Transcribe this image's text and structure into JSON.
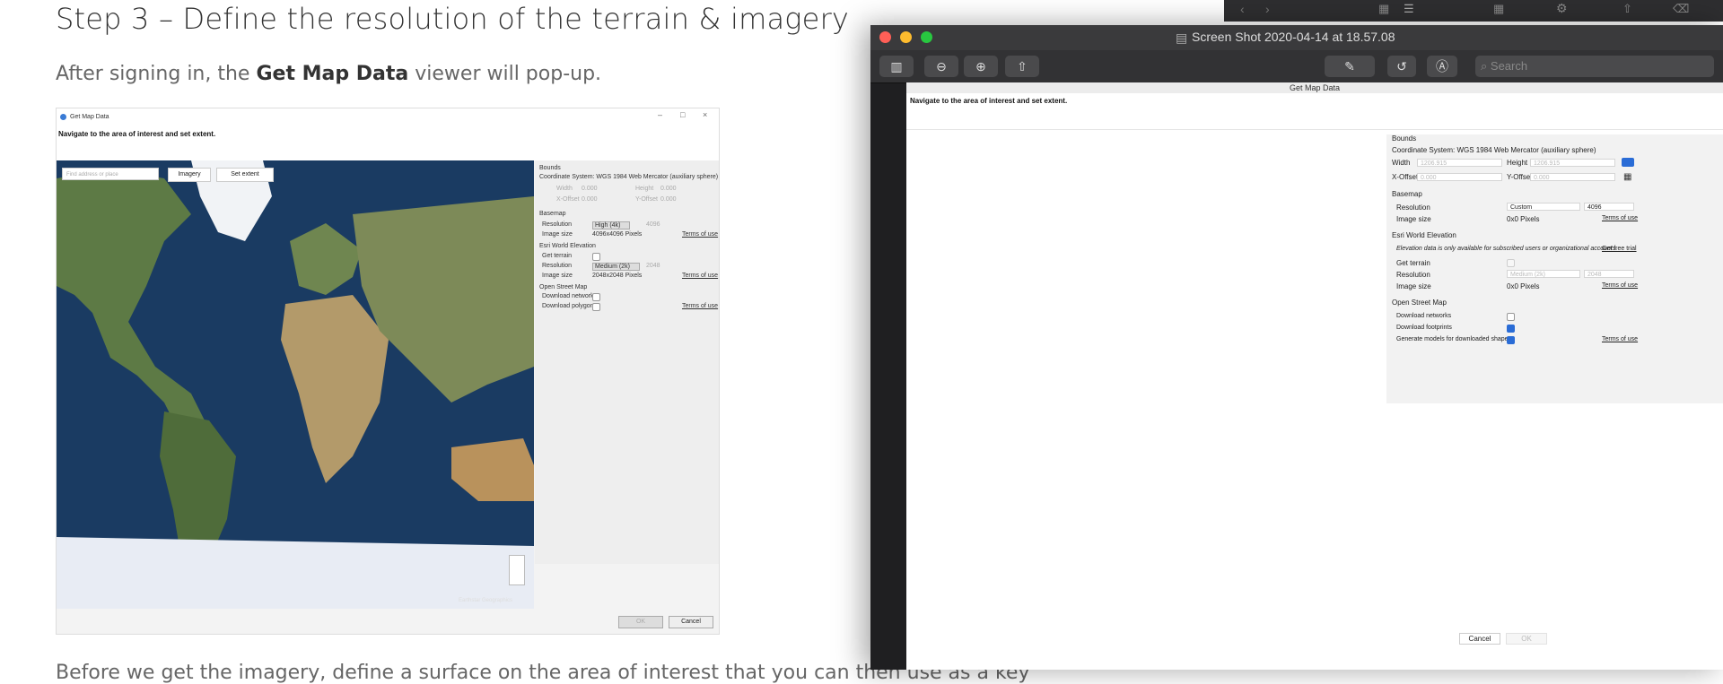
{
  "article": {
    "heading": "Step 3 – Define the resolution of the terrain & imagery",
    "intro_pre": "After signing in, the ",
    "intro_bold": "Get Map Data",
    "intro_post": " viewer will pop-up.",
    "cut_text": "Before we get the imagery, define a surface on the area of interest that you can then use as a key"
  },
  "shot": {
    "window_title": "Get Map Data",
    "instruction": "Navigate to the area of interest and set extent.",
    "search_placeholder": "Find address or place",
    "imagery_button": "Imagery",
    "set_extent_button": "Set extent",
    "attribution": "Earthstar Geographics",
    "bounds_header": "Bounds",
    "coord_system": "Coordinate System: WGS 1984 Web Mercator (auxiliary sphere)",
    "width_label": "Width",
    "width_value": "0.000",
    "height_label": "Height",
    "height_value": "0.000",
    "xoffset_label": "X-Offset",
    "xoffset_value": "0.000",
    "yoffset_label": "Y-Offset",
    "yoffset_value": "0.000",
    "basemap_header": "Basemap",
    "resolution_label": "Resolution",
    "basemap_resolution": "High (4k)",
    "basemap_res_value": "4096",
    "image_size_label": "Image size",
    "basemap_image_size": "4096x4096 Pixels",
    "terms": "Terms of use",
    "elevation_header": "Esri World Elevation",
    "get_terrain_label": "Get terrain",
    "elev_resolution": "Medium (2k)",
    "elev_res_value": "2048",
    "elev_image_size": "2048x2048 Pixels",
    "osm_header": "Open Street Map",
    "download_networks": "Download networks",
    "download_polygons": "Download polygons",
    "ok": "OK",
    "cancel": "Cancel"
  },
  "preview": {
    "title": "Screen Shot 2020-04-14 at 18.57.08",
    "search_placeholder": "Search",
    "doc_title": "Get Map Data",
    "instruction": "Navigate to the area of interest and set extent.",
    "bounds_header": "Bounds",
    "coord_system": "Coordinate System: WGS 1984 Web Mercator (auxiliary sphere)",
    "width_label": "Width",
    "width_value": "1206.915",
    "height_label": "Height",
    "height_value": "1206.915",
    "xoffset_label": "X-Offset",
    "xoffset_value": "0.000",
    "yoffset_label": "Y-Offset",
    "yoffset_value": "0.000",
    "basemap_header": "Basemap",
    "resolution_label": "Resolution",
    "basemap_resolution": "Custom",
    "basemap_res_value": "4096",
    "image_size_label": "Image size",
    "basemap_image_size": "0x0 Pixels",
    "terms": "Terms of use",
    "elevation_header": "Esri World Elevation",
    "elevation_note": "Elevation data is only available for subscribed users or organizational accounts.",
    "free_trial": "Get free trial",
    "get_terrain_label": "Get terrain",
    "elev_resolution": "Medium (2k)",
    "elev_res_value": "2048",
    "elev_image_size": "0x0 Pixels",
    "osm_header": "Open Street Map",
    "download_networks": "Download networks",
    "download_footprints": "Download footprints",
    "generate_models": "Generate models for downloaded shapes",
    "cancel": "Cancel",
    "ok": "OK"
  },
  "colors": {
    "accent": "#2a6cd6",
    "close": "#ff5f57",
    "minimize": "#febc2e",
    "zoom": "#28c840"
  }
}
